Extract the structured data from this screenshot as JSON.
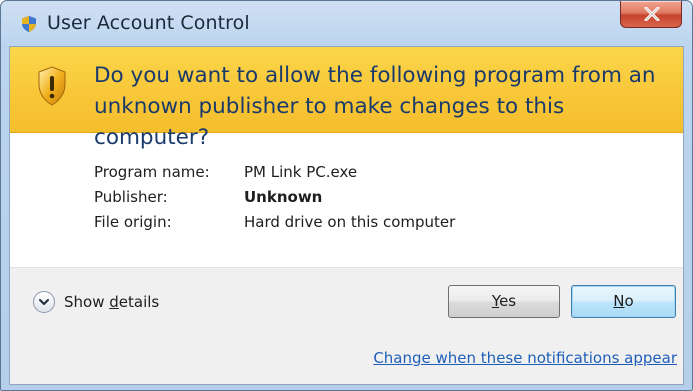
{
  "window": {
    "title": "User Account Control",
    "title_icon": "uac-shield-icon",
    "close_icon": "close-x-icon"
  },
  "banner": {
    "icon": "warning-shield-icon",
    "question": "Do you want to allow the following program from an unknown publisher to make changes to this computer?"
  },
  "details": [
    {
      "label": "Program name:",
      "value": "PM Link PC.exe",
      "bold": false
    },
    {
      "label": "Publisher:",
      "value": "Unknown",
      "bold": true
    },
    {
      "label": "File origin:",
      "value": "Hard drive on this computer",
      "bold": false
    }
  ],
  "footer": {
    "show_details_prefix": "Show ",
    "show_details_accel": "d",
    "show_details_suffix": "etails",
    "yes_accel": "Y",
    "yes_rest": "es",
    "no_accel": "N",
    "no_rest": "o",
    "change_link": "Change when these notifications appear"
  },
  "colors": {
    "banner": "#f8c83a",
    "question_text": "#1a3a6b",
    "link": "#1f5fb8",
    "close_button": "#c5432c"
  }
}
